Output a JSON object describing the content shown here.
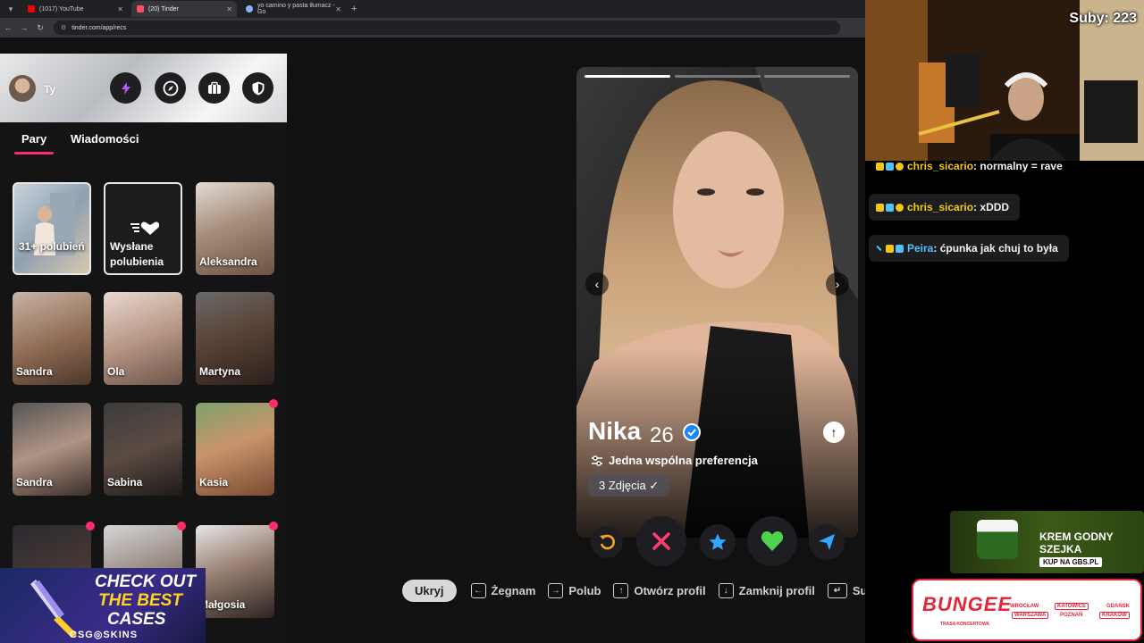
{
  "browser": {
    "tabs": [
      {
        "title": "(1017) YouTube",
        "favicon_color": "#ff0000"
      },
      {
        "title": "(20) Tinder",
        "favicon_color": "#fd5068"
      },
      {
        "title": "yo camino y pasta tłumacz - Go",
        "favicon_color": "#8ab4f8"
      }
    ],
    "url": "tinder.com/app/recs"
  },
  "sidebar": {
    "user_label": "Ty",
    "tabs": [
      "Pary",
      "Wiadomości"
    ],
    "likes_card_label": "31+ polubień",
    "sent_card_label": "Wysłane polubienia",
    "matches": [
      {
        "name": "Aleksandra",
        "new": false
      },
      {
        "name": "Sandra",
        "new": false
      },
      {
        "name": "Ola",
        "new": false
      },
      {
        "name": "Martyna",
        "new": false
      },
      {
        "name": "Sandra",
        "new": false
      },
      {
        "name": "Sabina",
        "new": false
      },
      {
        "name": "Kasia",
        "new": true
      },
      {
        "name": "",
        "new": true
      },
      {
        "name": "",
        "new": true
      },
      {
        "name": "Małgosia",
        "new": true
      }
    ]
  },
  "promo": {
    "line1": "CHECK OUT",
    "line2": "THE BEST",
    "line3": "CASES",
    "brand": "CSG◎SKINS"
  },
  "profile": {
    "name": "Nika",
    "age": "26",
    "preference": "Jedna wspólna preferencja",
    "photos_chip": "3 Zdjęcia ✓",
    "photo_count": 3,
    "current_photo": 1
  },
  "hints": {
    "hide": "Ukryj",
    "items": [
      {
        "key": "←",
        "label": "Żegnam"
      },
      {
        "key": "→",
        "label": "Polub"
      },
      {
        "key": "↑",
        "label": "Otwórz profil"
      },
      {
        "key": "↓",
        "label": "Zamknij profil"
      },
      {
        "key": "↵",
        "label": "Super Like"
      }
    ]
  },
  "stream": {
    "subs": "Suby: 223",
    "chat": [
      {
        "user": "chris_sicario",
        "text": "normalny = rave",
        "color": "#f5c518"
      },
      {
        "user": "chris_sicario",
        "text": "xDDD",
        "color": "#f5c518"
      },
      {
        "user": "Peira",
        "text": "ćpunka jak chuj to była",
        "color": "#4fc3f7"
      }
    ]
  },
  "ads": {
    "cream_line1": "KREM GODNY",
    "cream_line2": "SZEJKA",
    "cream_cta": "KUP NA GBS.PL",
    "bungee_brand": "BUNGEE",
    "bungee_sub": "TRASA KONCERTOWA",
    "bungee_cities": [
      "WROCŁAW",
      "KATOWICE",
      "GDAŃSK",
      "WARSZAWA",
      "POZNAŃ",
      "KRAKÓW"
    ]
  },
  "colors": {
    "accent": "#fd2d6c",
    "verified": "#1786ff",
    "rewind": "#f5a623",
    "nope": "#fe3c72",
    "superlike": "#31a8ff",
    "like": "#4fd34c",
    "boost": "#31a8ff"
  }
}
